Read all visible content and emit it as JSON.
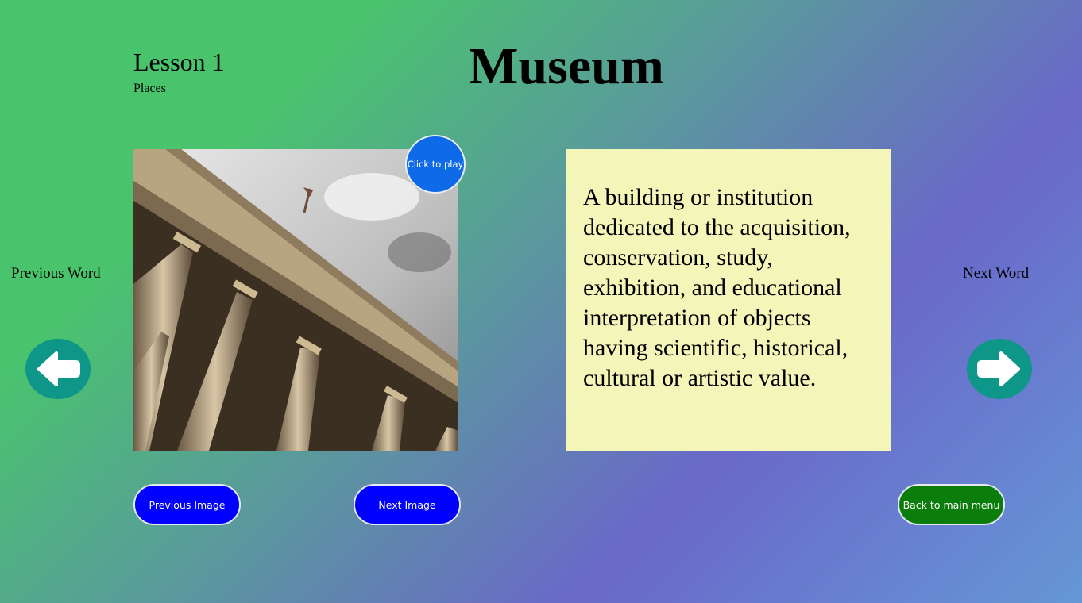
{
  "lesson": {
    "title": "Lesson 1",
    "category": "Places"
  },
  "word": "Museum",
  "definition": "A building or institution dedicated to the acquisition, conservation, study, exhibition, and educational interpretation of objects having scientific, historical, cultural or artistic value.",
  "navigation": {
    "previous_word_label": "Previous Word",
    "next_word_label": "Next Word",
    "previous_icon": "arrow-left-icon",
    "next_icon": "arrow-right-icon"
  },
  "media": {
    "play_label": "Click to play"
  },
  "buttons": {
    "previous_image": "Previous Image",
    "next_image": "Next Image",
    "back_to_menu": "Back to main menu"
  },
  "colors": {
    "gradient_start": "#49c46d",
    "gradient_mid": "#6a68c9",
    "gradient_end": "#6597d6",
    "arrow_button": "#0e9688",
    "play_button": "#0f6ae8",
    "image_button": "#0000ff",
    "menu_button": "#0a7d0a",
    "definition_card": "#f3f5b9"
  }
}
